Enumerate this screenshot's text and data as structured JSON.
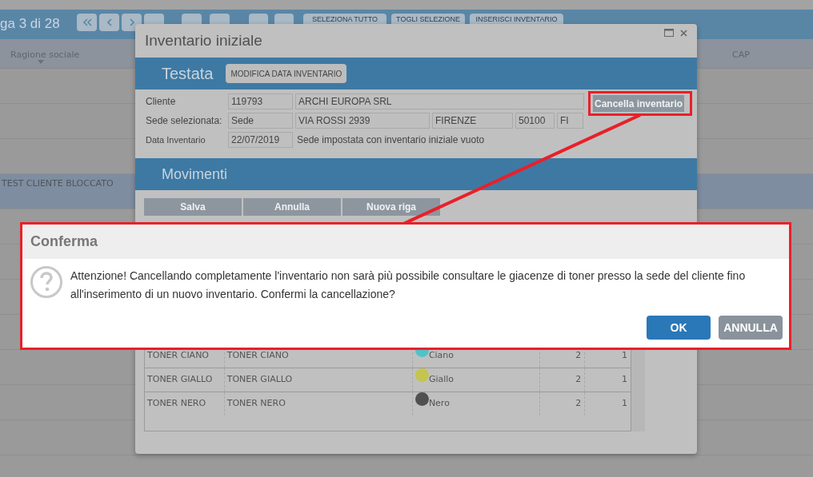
{
  "pager": {
    "label": "ga 3 di 28"
  },
  "toolbar": {
    "buttons": [
      "SELEZIONA TUTTO",
      "TOGLI SELEZIONE",
      "INSERISCI INVENTARIO"
    ]
  },
  "grid": {
    "columns": [
      "Ragione sociale",
      "CAP"
    ],
    "rows": [
      {
        "selected": false
      },
      {
        "selected": false
      },
      {
        "selected": false
      },
      {
        "selected": true,
        "ragione_sociale": "TEST CLIENTE BLOCCATO"
      },
      {
        "selected": false
      },
      {
        "selected": false
      },
      {
        "selected": false
      },
      {
        "selected": false
      },
      {
        "selected": false
      },
      {
        "selected": false
      },
      {
        "selected": false
      }
    ]
  },
  "modal": {
    "title": "Inventario iniziale",
    "testata": {
      "title": "Testata",
      "button": "MODIFICA DATA INVENTARIO",
      "cancel_button": "Cancella inventario",
      "rows": [
        {
          "label": "Cliente",
          "fields": [
            "119793",
            "ARCHI EUROPA SRL"
          ]
        },
        {
          "label": "Sede selezionata:",
          "fields": [
            "Sede",
            "VIA ROSSI 2939",
            "FIRENZE",
            "50100",
            "FI"
          ]
        },
        {
          "label": "Data Inventario",
          "fields": [
            "22/07/2019"
          ],
          "note": "Sede impostata con inventario iniziale vuoto"
        }
      ]
    },
    "movimenti": {
      "title": "Movimenti",
      "buttons": [
        "Salva",
        "Annulla",
        "Nuova riga"
      ],
      "rows": [
        {
          "codice": "TONER CIANO",
          "descrizione": "TONER CIANO",
          "colore": "Ciano",
          "color": "#4fc3c6",
          "column_4": "2",
          "column_5": "1"
        },
        {
          "codice": "TONER GIALLO",
          "descrizione": "TONER GIALLO",
          "colore": "Giallo",
          "color": "#c5c44e",
          "column_4": "2",
          "column_5": "1"
        },
        {
          "codice": "TONER NERO",
          "descrizione": "TONER NERO",
          "colore": "Nero",
          "color": "#505050",
          "column_4": "2",
          "column_5": "1"
        }
      ]
    }
  },
  "dialog": {
    "title": "Conferma",
    "message": "Attenzione! Cancellando completamente l'inventario non sarà più possibile consultare le giacenze di toner presso la sede del cliente fino all'inserimento di un nuovo inventario. Confermi la cancellazione?",
    "buttons": [
      {
        "label": "OK",
        "kind": "primary"
      },
      {
        "label": "ANNULLA",
        "kind": "secondary"
      }
    ]
  }
}
